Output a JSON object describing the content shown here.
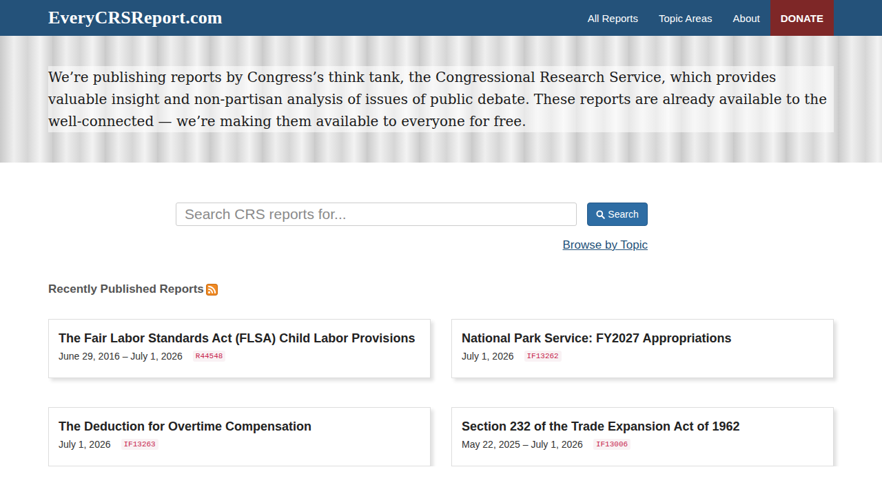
{
  "header": {
    "logo": "EveryCRSReport.com",
    "nav": [
      {
        "label": "All Reports"
      },
      {
        "label": "Topic Areas"
      },
      {
        "label": "About"
      }
    ],
    "donate": "DONATE"
  },
  "hero": {
    "text": "We’re publishing reports by Congress’s think tank, the Congressional Research Service, which provides valuable insight and non-partisan analysis of issues of public debate. These reports are already available to the well-connected — we’re making them available to everyone for free."
  },
  "search": {
    "placeholder": "Search CRS reports for...",
    "button": "Search",
    "browse_link": "Browse by Topic"
  },
  "recent": {
    "title": "Recently Published Reports",
    "reports": [
      {
        "title": "The Fair Labor Standards Act (FLSA) Child Labor Provisions",
        "date": "June 29, 2016 – July 1, 2026",
        "id": "R44548"
      },
      {
        "title": "National Park Service: FY2027 Appropriations",
        "date": "July 1, 2026",
        "id": "IF13262"
      },
      {
        "title": "The Deduction for Overtime Compensation",
        "date": "July 1, 2026",
        "id": "IF13263"
      },
      {
        "title": "Section 232 of the Trade Expansion Act of 1962",
        "date": "May 22, 2025 – July 1, 2026",
        "id": "IF13006"
      }
    ]
  }
}
